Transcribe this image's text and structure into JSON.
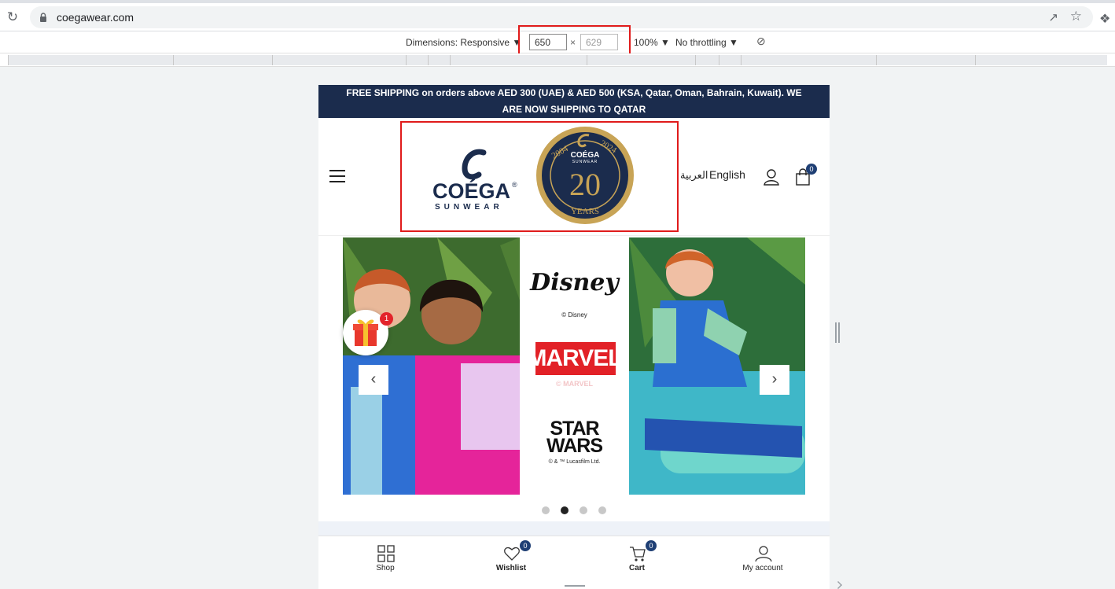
{
  "browser": {
    "url": "coegawear.com",
    "reload_icon": "reload-icon",
    "lock_icon": "lock-icon",
    "share_icon": "share-icon",
    "star_icon": "star-icon",
    "extensions_icon": "puzzle-icon"
  },
  "device_toolbar": {
    "dimensions_label": "Dimensions: Responsive ▼",
    "width": "650",
    "times": "×",
    "height": "629",
    "zoom": "100% ▼",
    "throttling": "No throttling ▼"
  },
  "site": {
    "announcement": "FREE SHIPPING on orders above AED 300 (UAE) & AED 500 (KSA, Qatar, Oman, Bahrain, Kuwait). WE ARE NOW SHIPPING TO QATAR",
    "logo": {
      "brand": "COÉGA",
      "reg": "®",
      "sub": "SUNWEAR"
    },
    "seal": {
      "year_start": "2004",
      "year_end": "2024",
      "brand": "COÉGA",
      "sub": "SUNWEAR",
      "number": "20",
      "label": "YEARS"
    },
    "lang_ar": "العربية",
    "lang_en": "English",
    "cart_count": "0",
    "colors": {
      "navy": "#1b2c4d",
      "badge": "#1f3f74",
      "marvel_red": "#e22127",
      "gift_badge": "#e3232a"
    }
  },
  "slider": {
    "brands": [
      {
        "name": "Disney",
        "copyright": "© Disney"
      },
      {
        "name": "MARVEL",
        "copyright": "© MARVEL"
      },
      {
        "name": "STAR WARS",
        "copyright": "© & ™ Lucasfilm Ltd."
      }
    ],
    "prev_arrow": "‹",
    "next_arrow": "›",
    "gift_count": "1",
    "active_slide": 2,
    "slide_count": 4
  },
  "bottom_nav": [
    {
      "label": "Shop",
      "icon": "grid-icon"
    },
    {
      "label": "Wishlist",
      "icon": "heart-icon",
      "count": "0"
    },
    {
      "label": "Cart",
      "icon": "cart-icon",
      "count": "0"
    },
    {
      "label": "My account",
      "icon": "user-icon"
    }
  ]
}
